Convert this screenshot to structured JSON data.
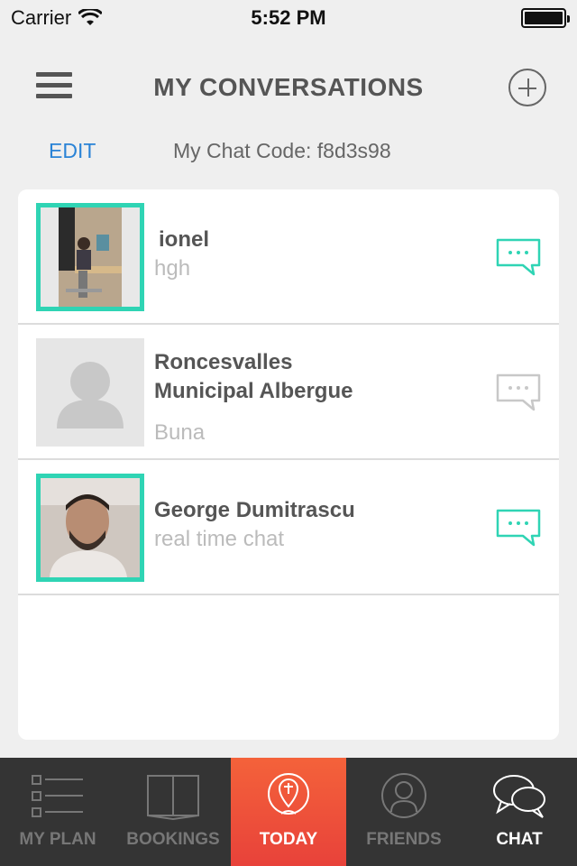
{
  "status_bar": {
    "carrier": "Carrier",
    "time": "5:52 PM"
  },
  "header": {
    "title": "MY CONVERSATIONS"
  },
  "subbar": {
    "edit_label": "EDIT",
    "chat_code": "My Chat Code: f8d3s98"
  },
  "conversations": [
    {
      "name": "ionel",
      "last_message": "hgh",
      "online": true
    },
    {
      "name_line1": "Roncesvalles",
      "name_line2": "Municipal Albergue",
      "last_message": "Buna",
      "online": false
    },
    {
      "name": "George Dumitrascu",
      "last_message": "real time chat",
      "online": true
    }
  ],
  "tabs": [
    {
      "label": "MY PLAN",
      "icon": "list-icon"
    },
    {
      "label": "BOOKINGS",
      "icon": "book-icon"
    },
    {
      "label": "TODAY",
      "icon": "pin-icon"
    },
    {
      "label": "FRIENDS",
      "icon": "person-icon"
    },
    {
      "label": "CHAT",
      "icon": "chat-bubbles-icon"
    }
  ],
  "colors": {
    "accent": "#2fd4b4",
    "edit": "#2a83d6",
    "today_tab": "#f4623a",
    "tabbar": "#343434"
  }
}
